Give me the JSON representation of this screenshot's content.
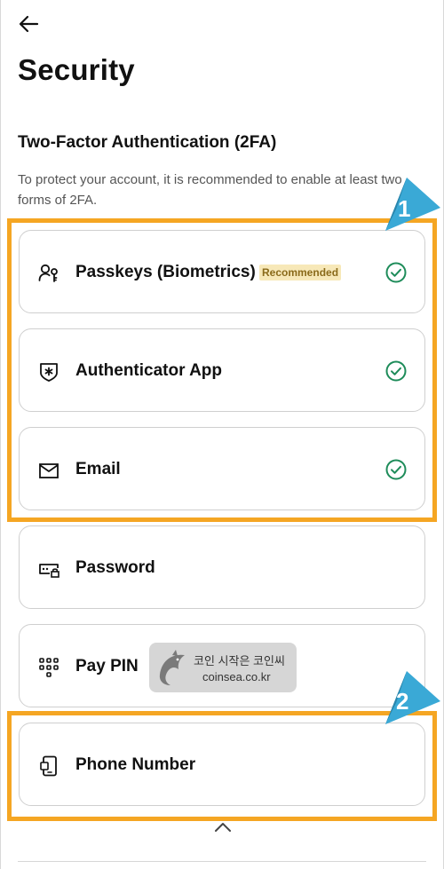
{
  "header": {
    "back_icon": "arrow-left-icon",
    "title": "Security"
  },
  "section": {
    "title": "Two-Factor Authentication (2FA)",
    "description": "To protect your account, it is recommended to enable at least two forms of 2FA."
  },
  "methods": [
    {
      "label": "Passkeys (Biometrics)",
      "icon": "passkey-person-icon",
      "badge": "Recommended",
      "enabled": true
    },
    {
      "label": "Authenticator App",
      "icon": "shield-asterisk-icon",
      "enabled": true
    },
    {
      "label": "Email",
      "icon": "envelope-icon",
      "enabled": true
    },
    {
      "label": "Password",
      "icon": "password-lock-icon",
      "enabled": false
    },
    {
      "label": "Pay PIN",
      "icon": "keypad-icon",
      "enabled": false
    },
    {
      "label": "Phone Number",
      "icon": "phone-icon",
      "enabled": false
    }
  ],
  "annotations": {
    "marker1": "1",
    "marker2": "2"
  },
  "watermark": {
    "line1": "코인 시작은 코인씨",
    "line2": "coinsea.co.kr"
  },
  "colors": {
    "highlight": "#f5a623",
    "marker": "#3aa9d6",
    "check": "#1e8c5a",
    "badge_bg": "#f7e8b8"
  }
}
